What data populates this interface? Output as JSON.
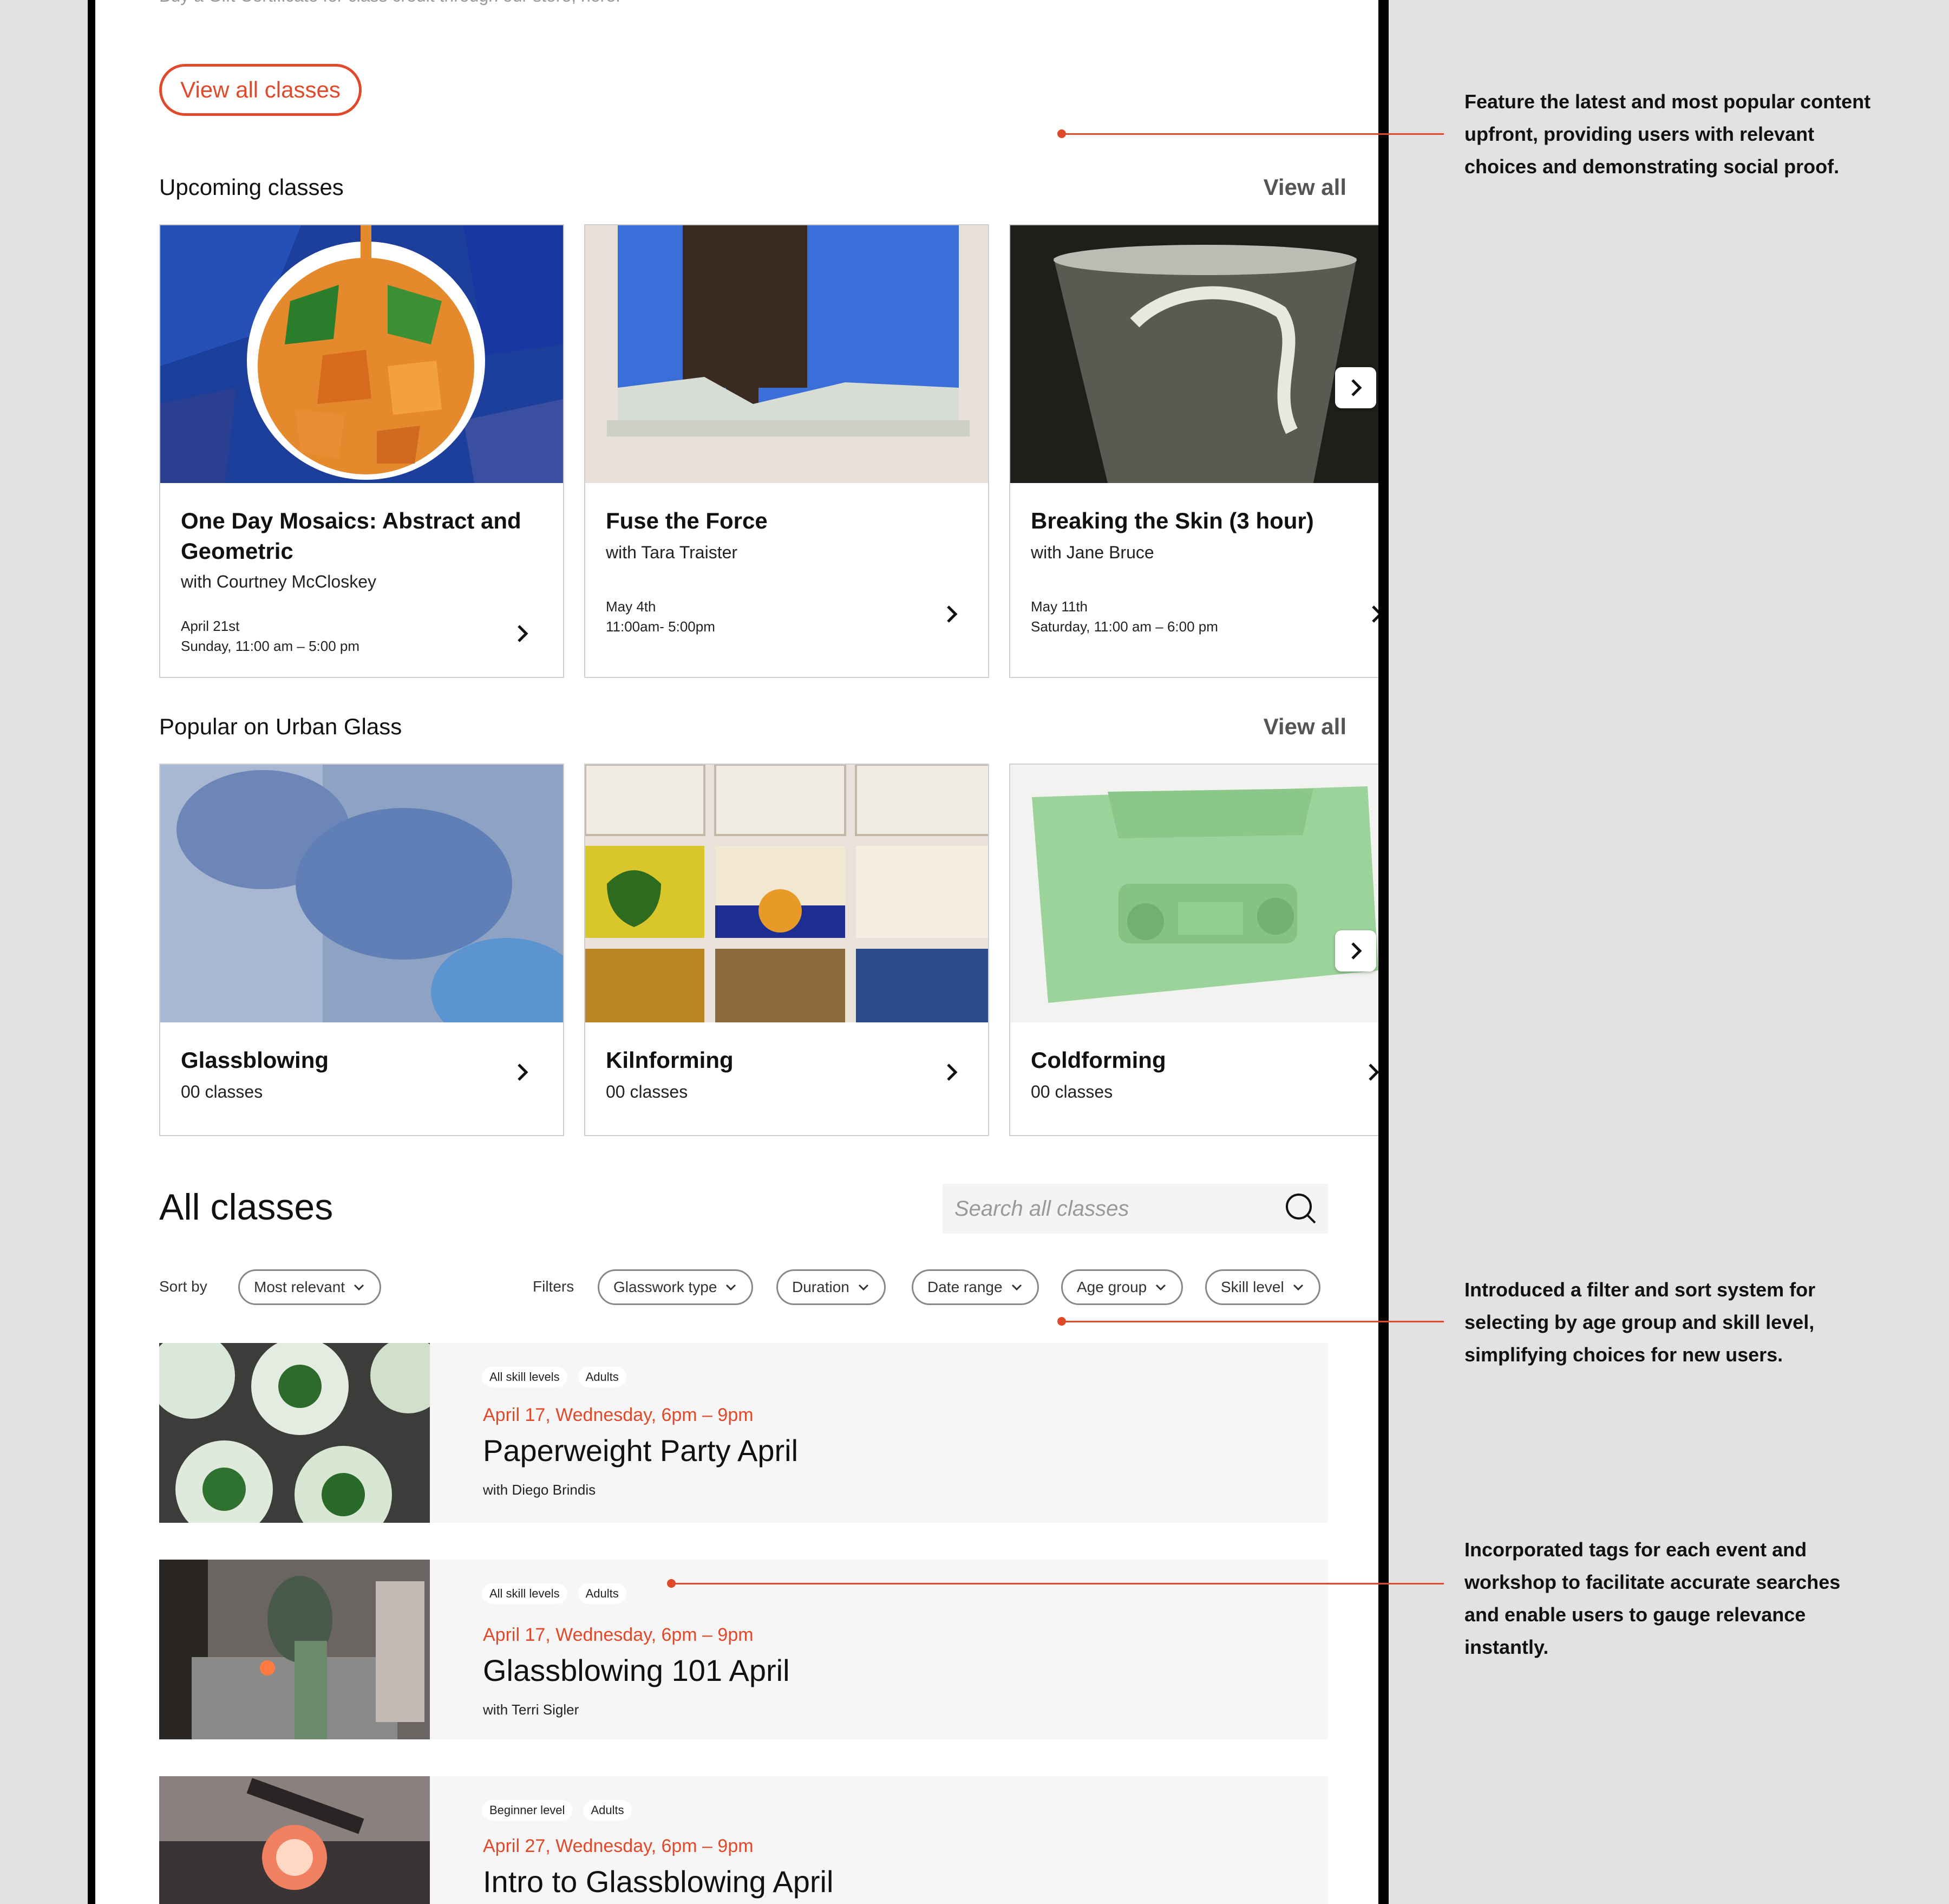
{
  "intro": {
    "cut_text": "Buy a Gift Certificate for class credit through our store, here."
  },
  "hero": {
    "view_all_classes": "View all classes"
  },
  "upcoming": {
    "title": "Upcoming classes",
    "view_all": "View all",
    "cards": [
      {
        "title": "One Day Mosaics: Abstract and Geometric",
        "instructor": "with Courtney McCloskey",
        "date_line1": "April 21st",
        "date_line2": "Sunday, 11:00 am – 5:00 pm"
      },
      {
        "title": "Fuse the Force",
        "instructor": "with Tara Traister",
        "date_line1": "May 4th",
        "date_line2": "11:00am- 5:00pm"
      },
      {
        "title": "Breaking the Skin (3 hour)",
        "instructor": "with Jane Bruce",
        "date_line1": "May 11th",
        "date_line2": "Saturday, 11:00 am – 6:00 pm"
      }
    ]
  },
  "popular": {
    "title": "Popular on Urban Glass",
    "view_all": "View all",
    "cards": [
      {
        "title": "Glassblowing",
        "count": "00 classes"
      },
      {
        "title": "Kilnforming",
        "count": "00 classes"
      },
      {
        "title": "Coldforming",
        "count": "00 classes"
      }
    ]
  },
  "all_classes": {
    "title": "All classes",
    "search_placeholder": "Search all classes",
    "sort_label": "Sort by",
    "sort_value": "Most relevant",
    "filters_label": "Filters",
    "filters": [
      "Glasswork type",
      "Duration",
      "Date range",
      "Age group",
      "Skill level"
    ],
    "rows": [
      {
        "tags": [
          "All skill levels",
          "Adults"
        ],
        "date": "April 17, Wednesday, 6pm – 9pm",
        "title": "Paperweight Party April",
        "instructor": "with Diego Brindis"
      },
      {
        "tags": [
          "All skill levels",
          "Adults"
        ],
        "date": "April 17, Wednesday, 6pm – 9pm",
        "title": "Glassblowing 101 April",
        "instructor": "with Terri Sigler"
      },
      {
        "tags": [
          "Beginner level",
          "Adults"
        ],
        "date": "April 27, Wednesday, 6pm – 9pm",
        "title": "Intro to Glassblowing April",
        "instructor": ""
      }
    ]
  },
  "annotations": [
    "Feature the latest and most popular content upfront, providing users with relevant choices and demonstrating social proof.",
    "Introduced a filter and sort system for selecting by age group and skill level, simplifying choices for new users.",
    "Incorporated tags for each event and workshop to facilitate accurate searches and enable users to gauge relevance instantly."
  ],
  "colors": {
    "accent": "#e04a2a",
    "background": "#e2e2e2",
    "row_bg": "#f6f6f6"
  }
}
